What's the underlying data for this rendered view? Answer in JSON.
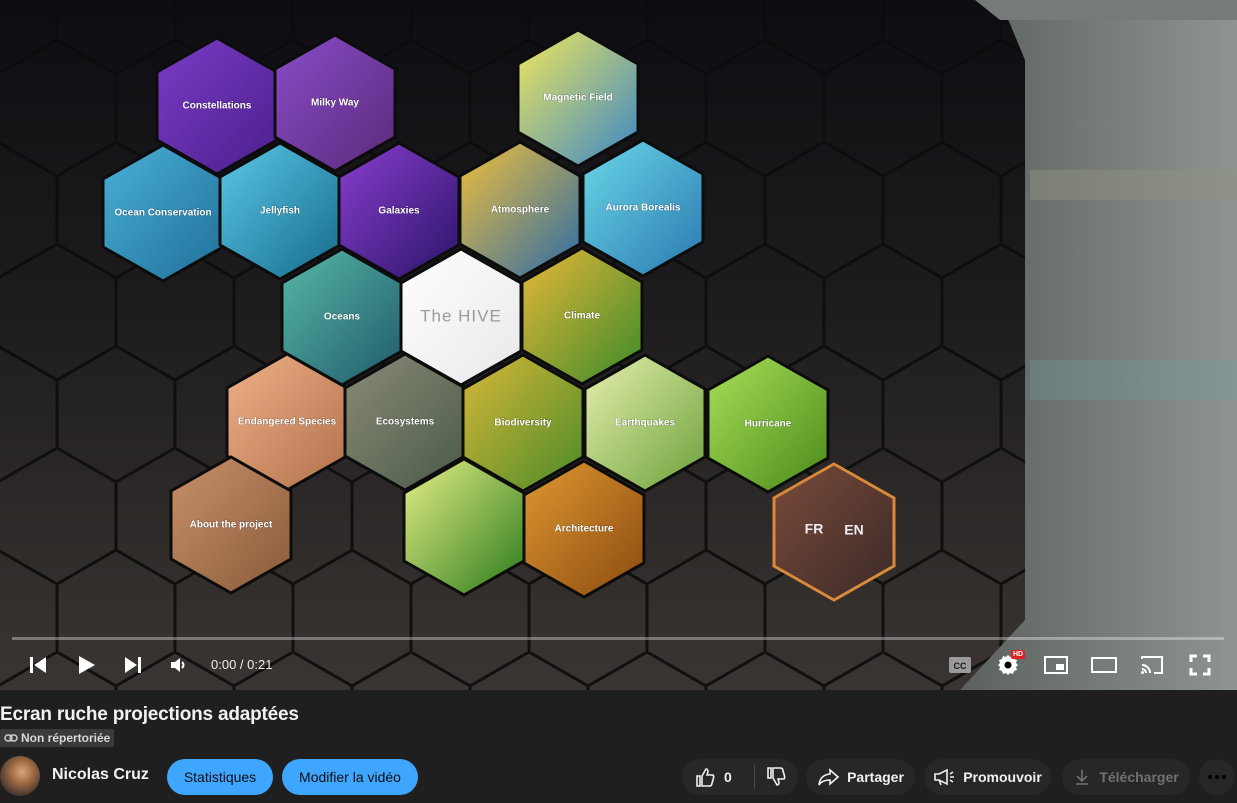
{
  "video": {
    "hexes": [
      {
        "label": "Constellations",
        "c1": "#7a3cc6",
        "c2": "#4b1f8c"
      },
      {
        "label": "Milky Way",
        "c1": "#8a4cc8",
        "c2": "#5a2a7a"
      },
      {
        "label": "Magnetic Field",
        "c1": "#f2e85a",
        "c2": "#3a86c8"
      },
      {
        "label": "Ocean Conservation",
        "c1": "#4ab0d8",
        "c2": "#1f6f98"
      },
      {
        "label": "Jellyfish",
        "c1": "#5cc8e8",
        "c2": "#146a8a"
      },
      {
        "label": "Galaxies",
        "c1": "#8a3ed0",
        "c2": "#2a1468"
      },
      {
        "label": "Atmosphere",
        "c1": "#f2c03a",
        "c2": "#2a6aa8"
      },
      {
        "label": "Aurora Borealis",
        "c1": "#6ad8e8",
        "c2": "#2a78b0"
      },
      {
        "label": "Oceans",
        "c1": "#58b8a8",
        "c2": "#1f5a6a"
      },
      {
        "label": "The HIVE",
        "c1": "#ffffff",
        "c2": "#e8e8e8"
      },
      {
        "label": "Climate",
        "c1": "#e8b838",
        "c2": "#3a8a2a"
      },
      {
        "label": "Endangered Species",
        "c1": "#f0b088",
        "c2": "#b0704a"
      },
      {
        "label": "Ecosystems",
        "c1": "#8a8a78",
        "c2": "#4a5a48"
      },
      {
        "label": "Biodiversity",
        "c1": "#d8b838",
        "c2": "#4a8a28"
      },
      {
        "label": "Earthquakes",
        "c1": "#e8f0b0",
        "c2": "#6aa038"
      },
      {
        "label": "Hurricane",
        "c1": "#a8e058",
        "c2": "#4a8a1a"
      },
      {
        "label": "About the project",
        "c1": "#c8906a",
        "c2": "#8a5a3a"
      },
      {
        "label": "",
        "c1": "#e8f088",
        "c2": "#2a7a1a"
      },
      {
        "label": "Architecture",
        "c1": "#e09830",
        "c2": "#8a4a10"
      },
      {
        "label_fr": "FR",
        "label_en": "EN",
        "c1": "#7a4a3a",
        "c2": "#3a2a28"
      }
    ]
  },
  "player": {
    "time_display": "0:00 / 0:21",
    "progress": 0,
    "hd_badge": "HD",
    "icons": [
      "skip-previous-icon",
      "play-icon",
      "skip-next-icon",
      "volume-icon",
      "captions-icon",
      "settings-icon",
      "miniplayer-icon",
      "theater-mode-icon",
      "cast-icon",
      "fullscreen-icon"
    ]
  },
  "meta": {
    "title": "Ecran ruche projections adaptées",
    "visibility": "Non répertoriée",
    "channel": "Nicolas Cruz",
    "stats_button": "Statistiques",
    "edit_button": "Modifier la vidéo",
    "like_count": "0",
    "share_button": "Partager",
    "promote_button": "Promouvoir",
    "download_button": "Télécharger"
  },
  "colors": {
    "accent_blue": "#3ea6ff",
    "page_background": "#1f1f1f",
    "pill_background": "#272727"
  }
}
